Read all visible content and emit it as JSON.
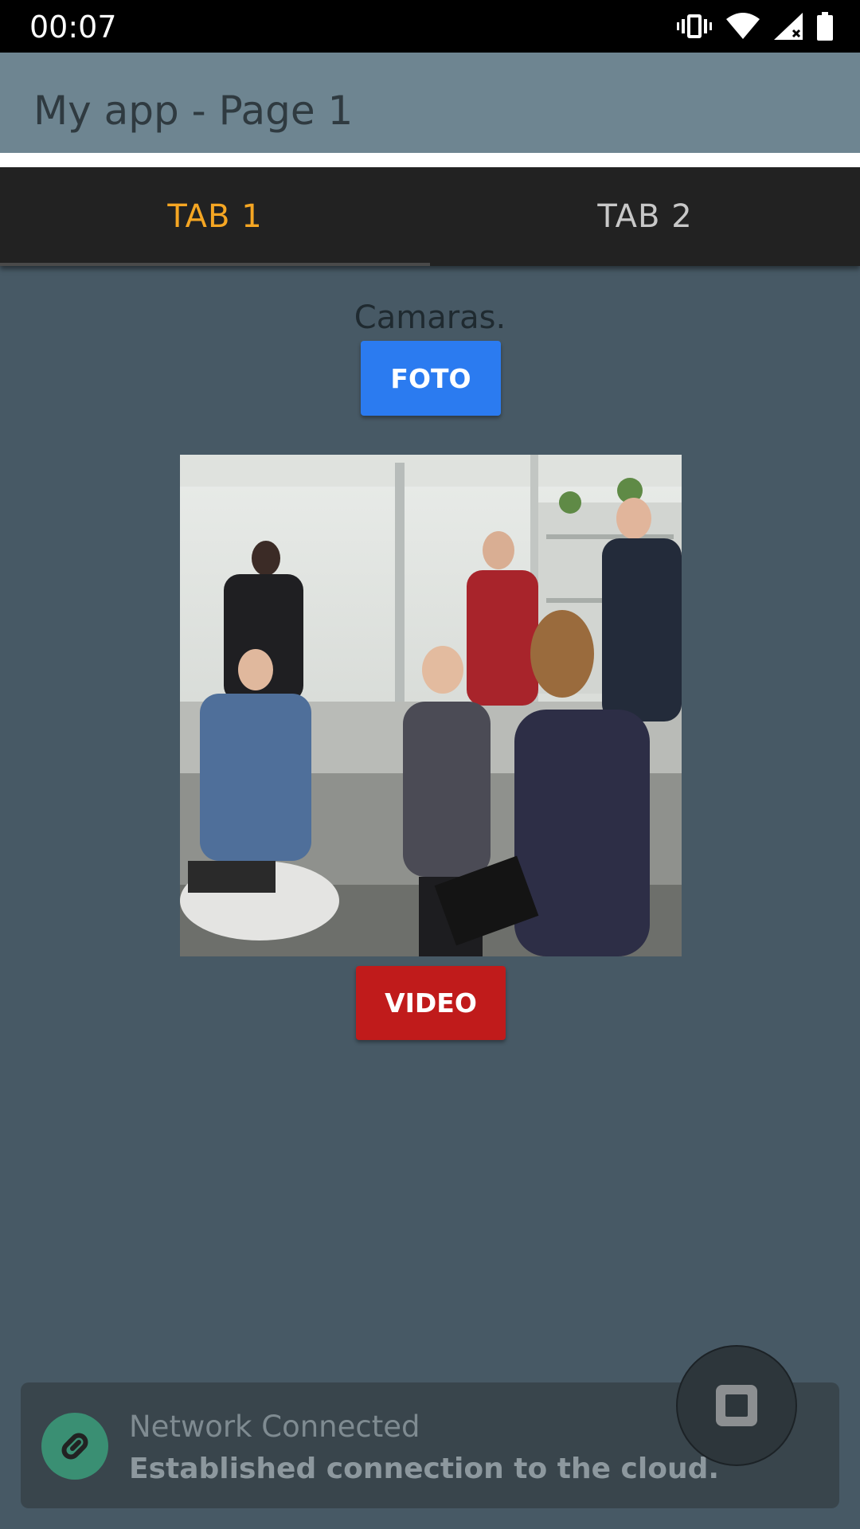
{
  "status_bar": {
    "time": "00:07",
    "icons": [
      "vibrate-icon",
      "wifi-icon",
      "cell-signal-icon",
      "battery-icon"
    ]
  },
  "app_bar": {
    "title": "My app - Page 1"
  },
  "tabs": [
    {
      "label": "TAB 1",
      "selected": true
    },
    {
      "label": "TAB 2",
      "selected": false
    }
  ],
  "content": {
    "section_label": "Camaras.",
    "foto_button": "FOTO",
    "video_button": "VIDEO"
  },
  "toast": {
    "title": "Network Connected",
    "message": "Established connection to the cloud.",
    "icon": "link-icon"
  },
  "fab": {
    "icon": "stop-icon"
  },
  "colors": {
    "accent_tab": "#f5a623",
    "foto_button": "#2b7bf0",
    "video_button": "#c01b1b",
    "background": "#475965"
  }
}
